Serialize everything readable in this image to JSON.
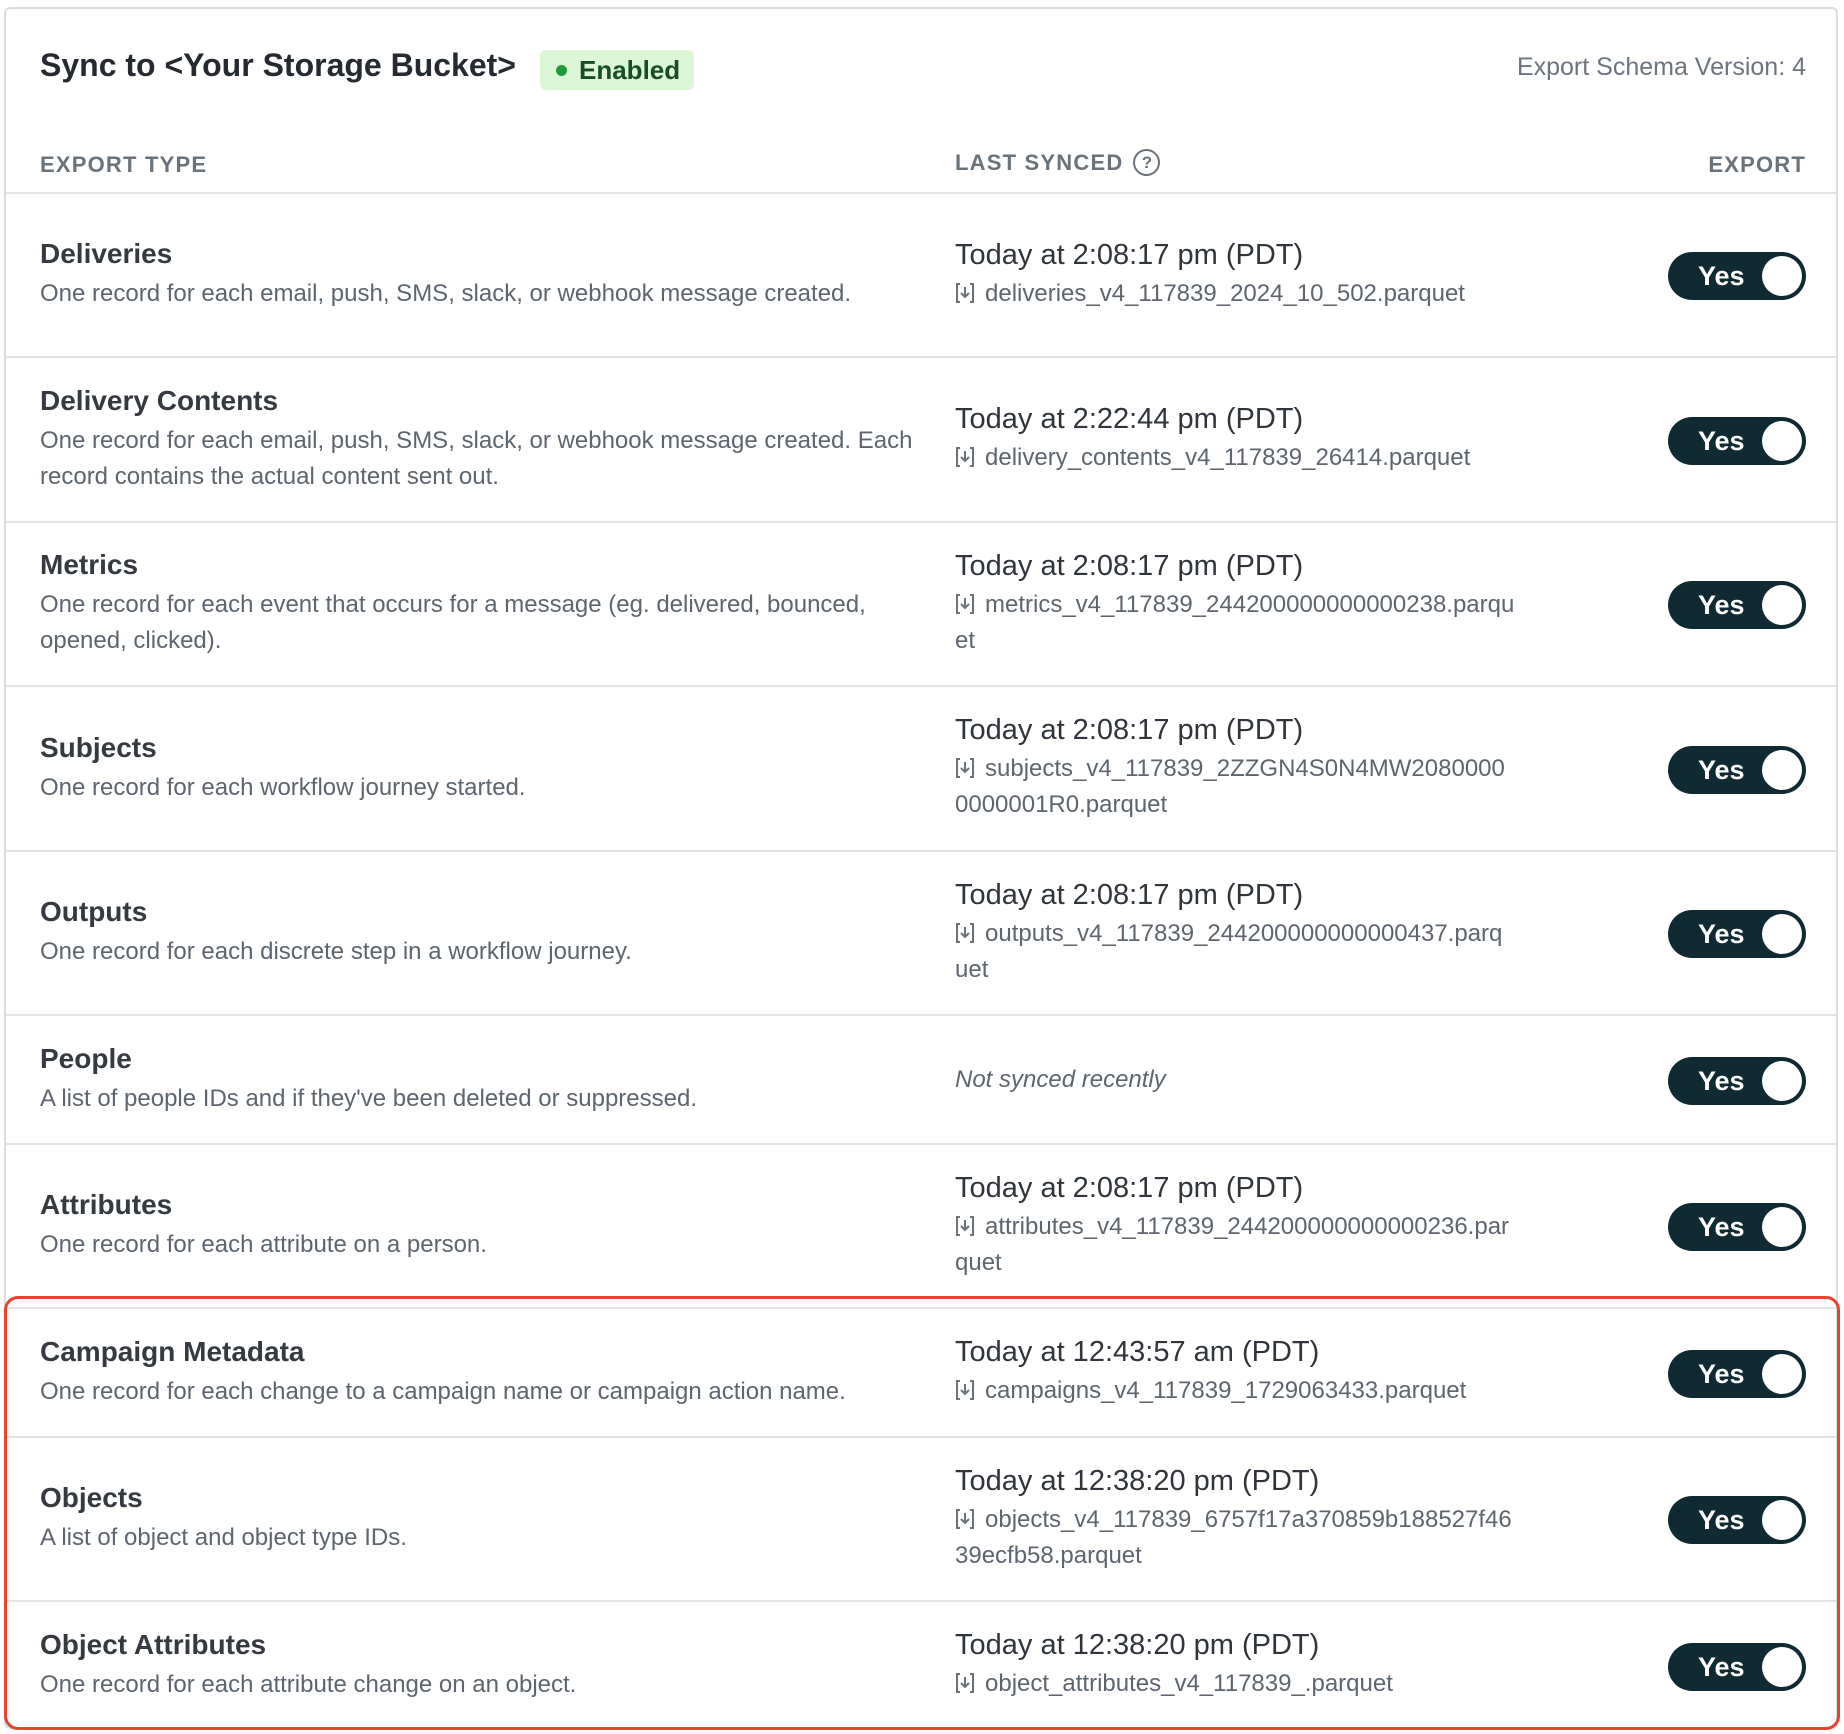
{
  "header": {
    "title": "Sync to <Your Storage Bucket>",
    "status_badge": "Enabled",
    "schema_version": "Export Schema Version: 4"
  },
  "columns": {
    "export_type": "EXPORT TYPE",
    "last_synced": "LAST SYNCED",
    "help_glyph": "?",
    "export": "EXPORT"
  },
  "icons": {
    "help": "question-circle-icon",
    "download": "download-icon"
  },
  "colors": {
    "toggle_on": "#0f2a32",
    "badge_bg": "#dcf7d6",
    "badge_dot": "#1f9b3a",
    "highlight": "#e8432e"
  },
  "rows": [
    {
      "name": "Deliveries",
      "description": "One record for each email, push, SMS, slack, or webhook message created.",
      "last_synced": "Today at 2:08:17 pm (PDT)",
      "file": "deliveries_v4_117839_2024_10_502.parquet",
      "export": "Yes"
    },
    {
      "name": "Delivery Contents",
      "description": "One record for each email, push, SMS, slack, or webhook message created. Each record contains the actual content sent out.",
      "last_synced": "Today at 2:22:44 pm (PDT)",
      "file": "delivery_contents_v4_117839_26414.parquet",
      "export": "Yes"
    },
    {
      "name": "Metrics",
      "description": "One record for each event that occurs for a message (eg. delivered, bounced, opened, clicked).",
      "last_synced": "Today at 2:08:17 pm (PDT)",
      "file": "metrics_v4_117839_244200000000000238.parquet",
      "export": "Yes"
    },
    {
      "name": "Subjects",
      "description": "One record for each workflow journey started.",
      "last_synced": "Today at 2:08:17 pm (PDT)",
      "file": "subjects_v4_117839_2ZZGN4S0N4MW20800000000001R0.parquet",
      "export": "Yes"
    },
    {
      "name": "Outputs",
      "description": "One record for each discrete step in a workflow journey.",
      "last_synced": "Today at 2:08:17 pm (PDT)",
      "file": "outputs_v4_117839_244200000000000437.parquet",
      "export": "Yes"
    },
    {
      "name": "People",
      "description": "A list of people IDs and if they've been deleted or suppressed.",
      "last_synced_note": "Not synced recently",
      "export": "Yes"
    },
    {
      "name": "Attributes",
      "description": "One record for each attribute on a person.",
      "last_synced": "Today at 2:08:17 pm (PDT)",
      "file": "attributes_v4_117839_244200000000000236.parquet",
      "export": "Yes"
    },
    {
      "name": "Campaign Metadata",
      "description": "One record for each change to a campaign name or campaign action name.",
      "last_synced": "Today at 12:43:57 am (PDT)",
      "file": "campaigns_v4_117839_1729063433.parquet",
      "export": "Yes"
    },
    {
      "name": "Objects",
      "description": "A list of object and object type IDs.",
      "last_synced": "Today at 12:38:20 pm (PDT)",
      "file": "objects_v4_117839_6757f17a370859b188527f4639ecfb58.parquet",
      "export": "Yes"
    },
    {
      "name": "Object Attributes",
      "description": "One record for each attribute change on an object.",
      "last_synced": "Today at 12:38:20 pm (PDT)",
      "file": "object_attributes_v4_117839_.parquet",
      "export": "Yes"
    }
  ]
}
